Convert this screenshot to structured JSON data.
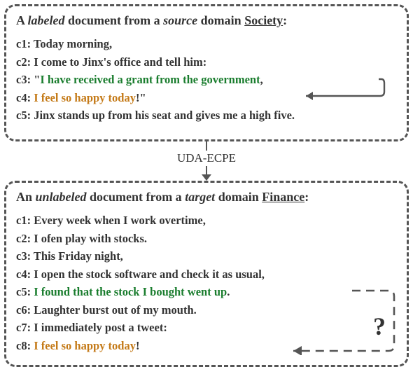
{
  "top_doc": {
    "title_prefix": "A ",
    "title_labeled": "labeled",
    "title_mid": " document from a ",
    "title_source": "source",
    "title_domain_pre": " domain ",
    "title_domain": "Society",
    "title_colon": ":",
    "lines": [
      {
        "key": "c1:",
        "segs": [
          {
            "text": " Today morning,",
            "cls": "plain"
          }
        ]
      },
      {
        "key": "c2:",
        "segs": [
          {
            "text": " I come to Jinx's office and tell him:",
            "cls": "plain"
          }
        ]
      },
      {
        "key": "c3:",
        "segs": [
          {
            "text": " \"",
            "cls": "plain"
          },
          {
            "text": "I have received a grant from the government",
            "cls": "green"
          },
          {
            "text": ",",
            "cls": "plain"
          }
        ]
      },
      {
        "key": "c4:",
        "segs": [
          {
            "text": " ",
            "cls": "plain"
          },
          {
            "text": "I feel so happy today",
            "cls": "orange"
          },
          {
            "text": "!\"",
            "cls": "plain"
          }
        ]
      },
      {
        "key": "c5:",
        "segs": [
          {
            "text": " Jinx stands up from his seat and gives me a high five.",
            "cls": "plain"
          }
        ]
      }
    ]
  },
  "connector_label": "UDA-ECPE",
  "bottom_doc": {
    "title_prefix": "An ",
    "title_labeled": "unlabeled",
    "title_mid": " document from a ",
    "title_source": "target",
    "title_domain_pre": " domain ",
    "title_domain": "Finance",
    "title_colon": ":",
    "lines": [
      {
        "key": "c1:",
        "segs": [
          {
            "text": " Every week when I work overtime,",
            "cls": "plain"
          }
        ]
      },
      {
        "key": "c2:",
        "segs": [
          {
            "text": " I ofen play with stocks.",
            "cls": "plain"
          }
        ]
      },
      {
        "key": "c3:",
        "segs": [
          {
            "text": " This Friday night,",
            "cls": "plain"
          }
        ]
      },
      {
        "key": "c4:",
        "segs": [
          {
            "text": " I open the stock software and check it as usual,",
            "cls": "plain"
          }
        ]
      },
      {
        "key": "c5:",
        "segs": [
          {
            "text": " ",
            "cls": "plain"
          },
          {
            "text": "I found that the stock I bought went up",
            "cls": "green"
          },
          {
            "text": ".",
            "cls": "plain"
          }
        ]
      },
      {
        "key": "c6:",
        "segs": [
          {
            "text": " Laughter burst out of my mouth.",
            "cls": "plain"
          }
        ]
      },
      {
        "key": "c7:",
        "segs": [
          {
            "text": " I immediately post a tweet:",
            "cls": "plain"
          }
        ]
      },
      {
        "key": "c8:",
        "segs": [
          {
            "text": " ",
            "cls": "plain"
          },
          {
            "text": "I feel so happy today",
            "cls": "orange"
          },
          {
            "text": "!",
            "cls": "plain"
          }
        ]
      }
    ]
  },
  "question_mark": "?"
}
